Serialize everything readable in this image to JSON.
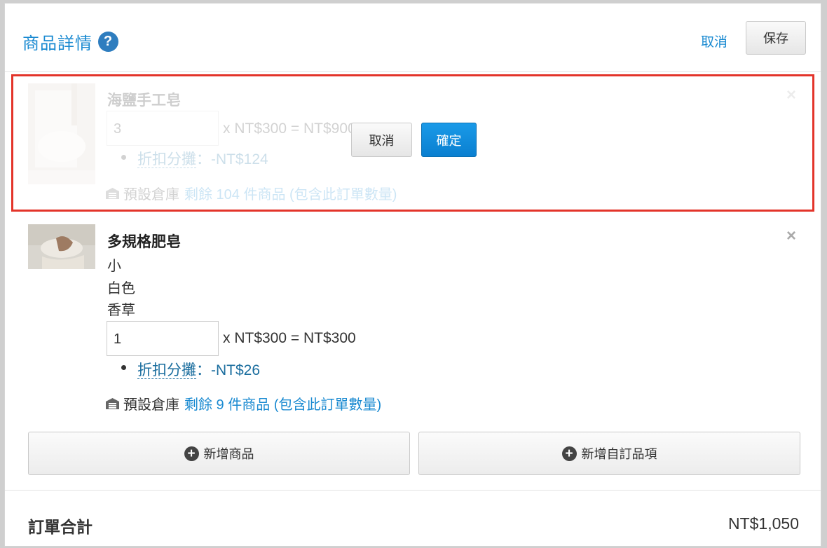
{
  "header": {
    "title": "商品詳情",
    "help_icon": "?",
    "cancel_label": "取消",
    "save_label": "保存"
  },
  "items": [
    {
      "name": "海鹽手工皂",
      "quantity": "3",
      "price_line": "x NT$300 = NT$900",
      "discount_label": "折扣分攤",
      "discount_value": "：-NT$124",
      "warehouse_label": "預設倉庫",
      "stock_text": "剩餘 104 件商品 (包含此訂單數量)",
      "remove_icon": "×",
      "state": "editing-faded"
    },
    {
      "name": "多規格肥皂",
      "variants": [
        "小",
        "白色",
        "香草"
      ],
      "quantity": "1",
      "price_line": "x NT$300 = NT$300",
      "discount_label": "折扣分攤",
      "discount_value": "：-NT$26",
      "warehouse_label": "預設倉庫",
      "stock_text": "剩餘 9 件商品 (包含此訂單數量)",
      "remove_icon": "×"
    }
  ],
  "overlay": {
    "cancel_label": "取消",
    "confirm_label": "確定",
    "highlight_color": "#e3342a"
  },
  "actions": {
    "add_product_label": "新增商品",
    "add_custom_label": "新增自訂品項"
  },
  "summary": {
    "total_label": "訂單合計",
    "total_value": "NT$1,050"
  },
  "colors": {
    "accent": "#1a8ad1",
    "primary_button": "#0a7fd0",
    "highlight": "#e3342a"
  }
}
